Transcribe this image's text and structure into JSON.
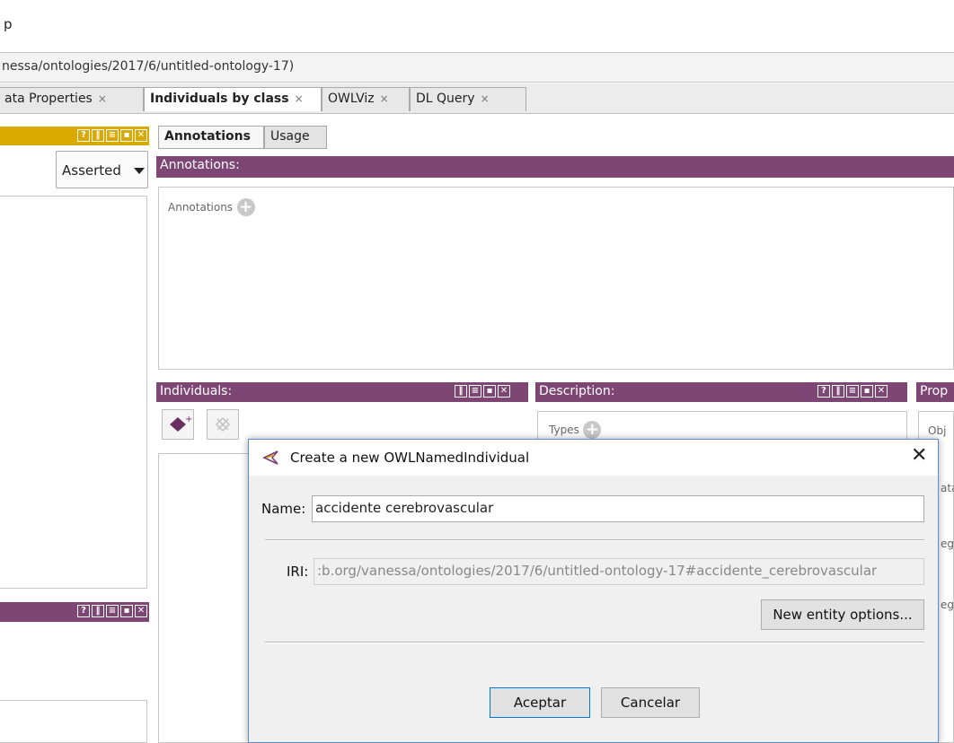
{
  "menubar": {
    "visible_text": "p"
  },
  "pathbar": {
    "iri": "nessa/ontologies/2017/6/untitled-ontology-17)"
  },
  "tabs": [
    {
      "label": "ata Properties",
      "close": "×"
    },
    {
      "label": "Individuals by class",
      "close": "×"
    },
    {
      "label": "OWLViz",
      "close": "×"
    },
    {
      "label": "DL Query",
      "close": "×"
    }
  ],
  "left_panel": {
    "hierarchy_mode": "Asserted"
  },
  "window_controls": {
    "help": "?",
    "split_v": "▮▮",
    "split_h": "☰",
    "max": "■",
    "close": "✕"
  },
  "annotations_panel": {
    "subtabs": [
      "Annotations",
      "Usage"
    ],
    "header": "Annotations:",
    "field_label": "Annotations"
  },
  "individuals_panel": {
    "header": "Individuals:"
  },
  "description_panel": {
    "header": "Description:",
    "types_label": "Types"
  },
  "property_panel": {
    "header": "Prop",
    "obj_label": "Obj",
    "row2": "ata",
    "row3": "eg",
    "row4": "eg"
  },
  "dialog": {
    "title": "Create a new OWLNamedIndividual",
    "close_glyph": "✕",
    "name_label": "Name:",
    "name_value": "accidente cerebrovascular",
    "iri_label": "IRI:",
    "iri_value": ":b.org/vanessa/ontologies/2017/6/untitled-ontology-17#accidente_cerebrovascular",
    "options_button": "New entity options...",
    "ok_button": "Aceptar",
    "cancel_button": "Cancelar"
  }
}
